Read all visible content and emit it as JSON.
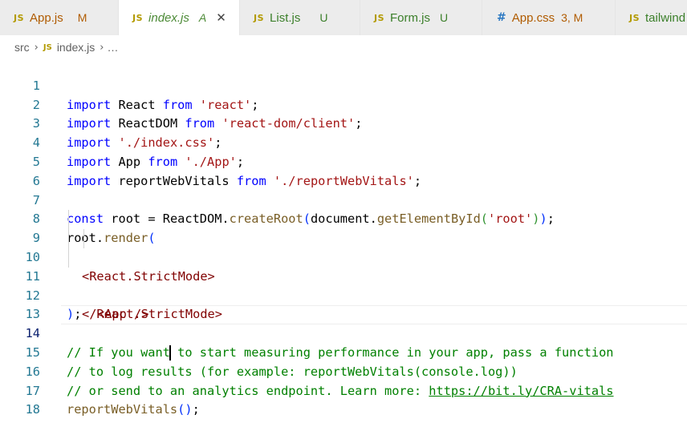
{
  "tabs": [
    {
      "icon": "JS",
      "name": "App.js",
      "status": "M",
      "active": false
    },
    {
      "icon": "JS",
      "name": "index.js",
      "status": "A",
      "active": true
    },
    {
      "icon": "JS",
      "name": "List.js",
      "status": "U",
      "active": false
    },
    {
      "icon": "JS",
      "name": "Form.js",
      "status": "U",
      "active": false
    },
    {
      "icon": "#",
      "name": "App.css",
      "status": "3, M",
      "active": false
    },
    {
      "icon": "JS",
      "name": "tailwind",
      "status": "",
      "active": false
    }
  ],
  "close_glyph": "✕",
  "breadcrumb": {
    "folder": "src",
    "file_icon": "JS",
    "file": "index.js",
    "more": "…"
  },
  "line_numbers": [
    "1",
    "2",
    "3",
    "4",
    "5",
    "6",
    "7",
    "8",
    "9",
    "10",
    "11",
    "12",
    "13",
    "14",
    "15",
    "16",
    "17",
    "18"
  ],
  "code": {
    "l1": {
      "a": "import",
      "b": " React ",
      "c": "from",
      "d": " ",
      "e": "'react'",
      "f": ";"
    },
    "l2": {
      "a": "import",
      "b": " ReactDOM ",
      "c": "from",
      "d": " ",
      "e": "'react-dom/client'",
      "f": ";"
    },
    "l3": {
      "a": "import",
      "b": " ",
      "e": "'./index.css'",
      "f": ";"
    },
    "l4": {
      "a": "import",
      "b": " App ",
      "c": "from",
      "d": " ",
      "e": "'./App'",
      "f": ";"
    },
    "l5": {
      "a": "import",
      "b": " reportWebVitals ",
      "c": "from",
      "d": " ",
      "e": "'./reportWebVitals'",
      "f": ";"
    },
    "l7": {
      "a": "const",
      "b": " root = ReactDOM.",
      "c": "createRoot",
      "d": "(",
      "e": "document.",
      "g": "getElementById",
      "h": "(",
      "i": "'root'",
      "j": ")",
      "k": ")",
      "l": ";"
    },
    "l8": {
      "a": "root.",
      "b": "render",
      "c": "("
    },
    "l9": {
      "a": "<React.StrictMode>"
    },
    "l10": {
      "a": "<App />"
    },
    "l11": {
      "a": "</React.StrictMode>"
    },
    "l12": {
      "a": ")",
      "b": ";"
    },
    "l14_a": "// If you want",
    "l14_b": " to start measuring performance in your app, pass a function",
    "l15": "// to log results (for example: reportWebVitals(console.log))",
    "l16_a": "// or send to an analytics endpoint. Learn more: ",
    "l16_link": "https://bit.ly/CRA-vitals",
    "l17": {
      "a": "reportWebVitals",
      "b": "(",
      "c": ")",
      "d": ";"
    }
  },
  "colors": {
    "keyword": "#0000ff",
    "string": "#a31515",
    "comment": "#008000",
    "function": "#795e26",
    "tag": "#800000",
    "line_number": "#237893"
  }
}
